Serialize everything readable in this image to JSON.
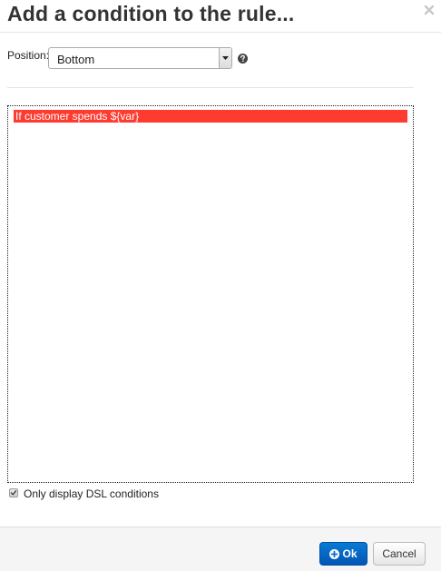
{
  "dialog": {
    "title": "Add a condition to the rule...",
    "close_icon": "close-icon"
  },
  "position": {
    "label": "Position:",
    "selected": "Bottom",
    "help_icon": "question-circle-icon"
  },
  "conditions": {
    "items": [
      {
        "label": "If customer spends ${var}",
        "selected": true
      }
    ],
    "highlight_color": "#ff3b30"
  },
  "dsl_filter": {
    "label": "Only display DSL conditions",
    "checked": true
  },
  "footer": {
    "ok_label": "Ok",
    "ok_icon": "plus-circle-icon",
    "cancel_label": "Cancel",
    "primary_color": "#0a6fcc"
  }
}
